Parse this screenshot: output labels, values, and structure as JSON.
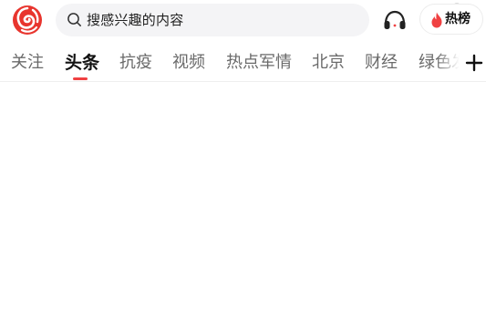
{
  "header": {
    "search": {
      "placeholder": "搜感兴趣的内容"
    },
    "hot_button": {
      "label": "热榜"
    },
    "logo": "phoenix-logo",
    "colors": {
      "brand_red": "#e8352e",
      "accent": "#f04142"
    }
  },
  "tabs": {
    "items": [
      {
        "label": "关注"
      },
      {
        "label": "头条"
      },
      {
        "label": "抗疫"
      },
      {
        "label": "视频"
      },
      {
        "label": "热点军情"
      },
      {
        "label": "北京"
      },
      {
        "label": "财经"
      },
      {
        "label": "绿色发展"
      }
    ],
    "active": "头条",
    "add_icon": "plus-icon"
  }
}
